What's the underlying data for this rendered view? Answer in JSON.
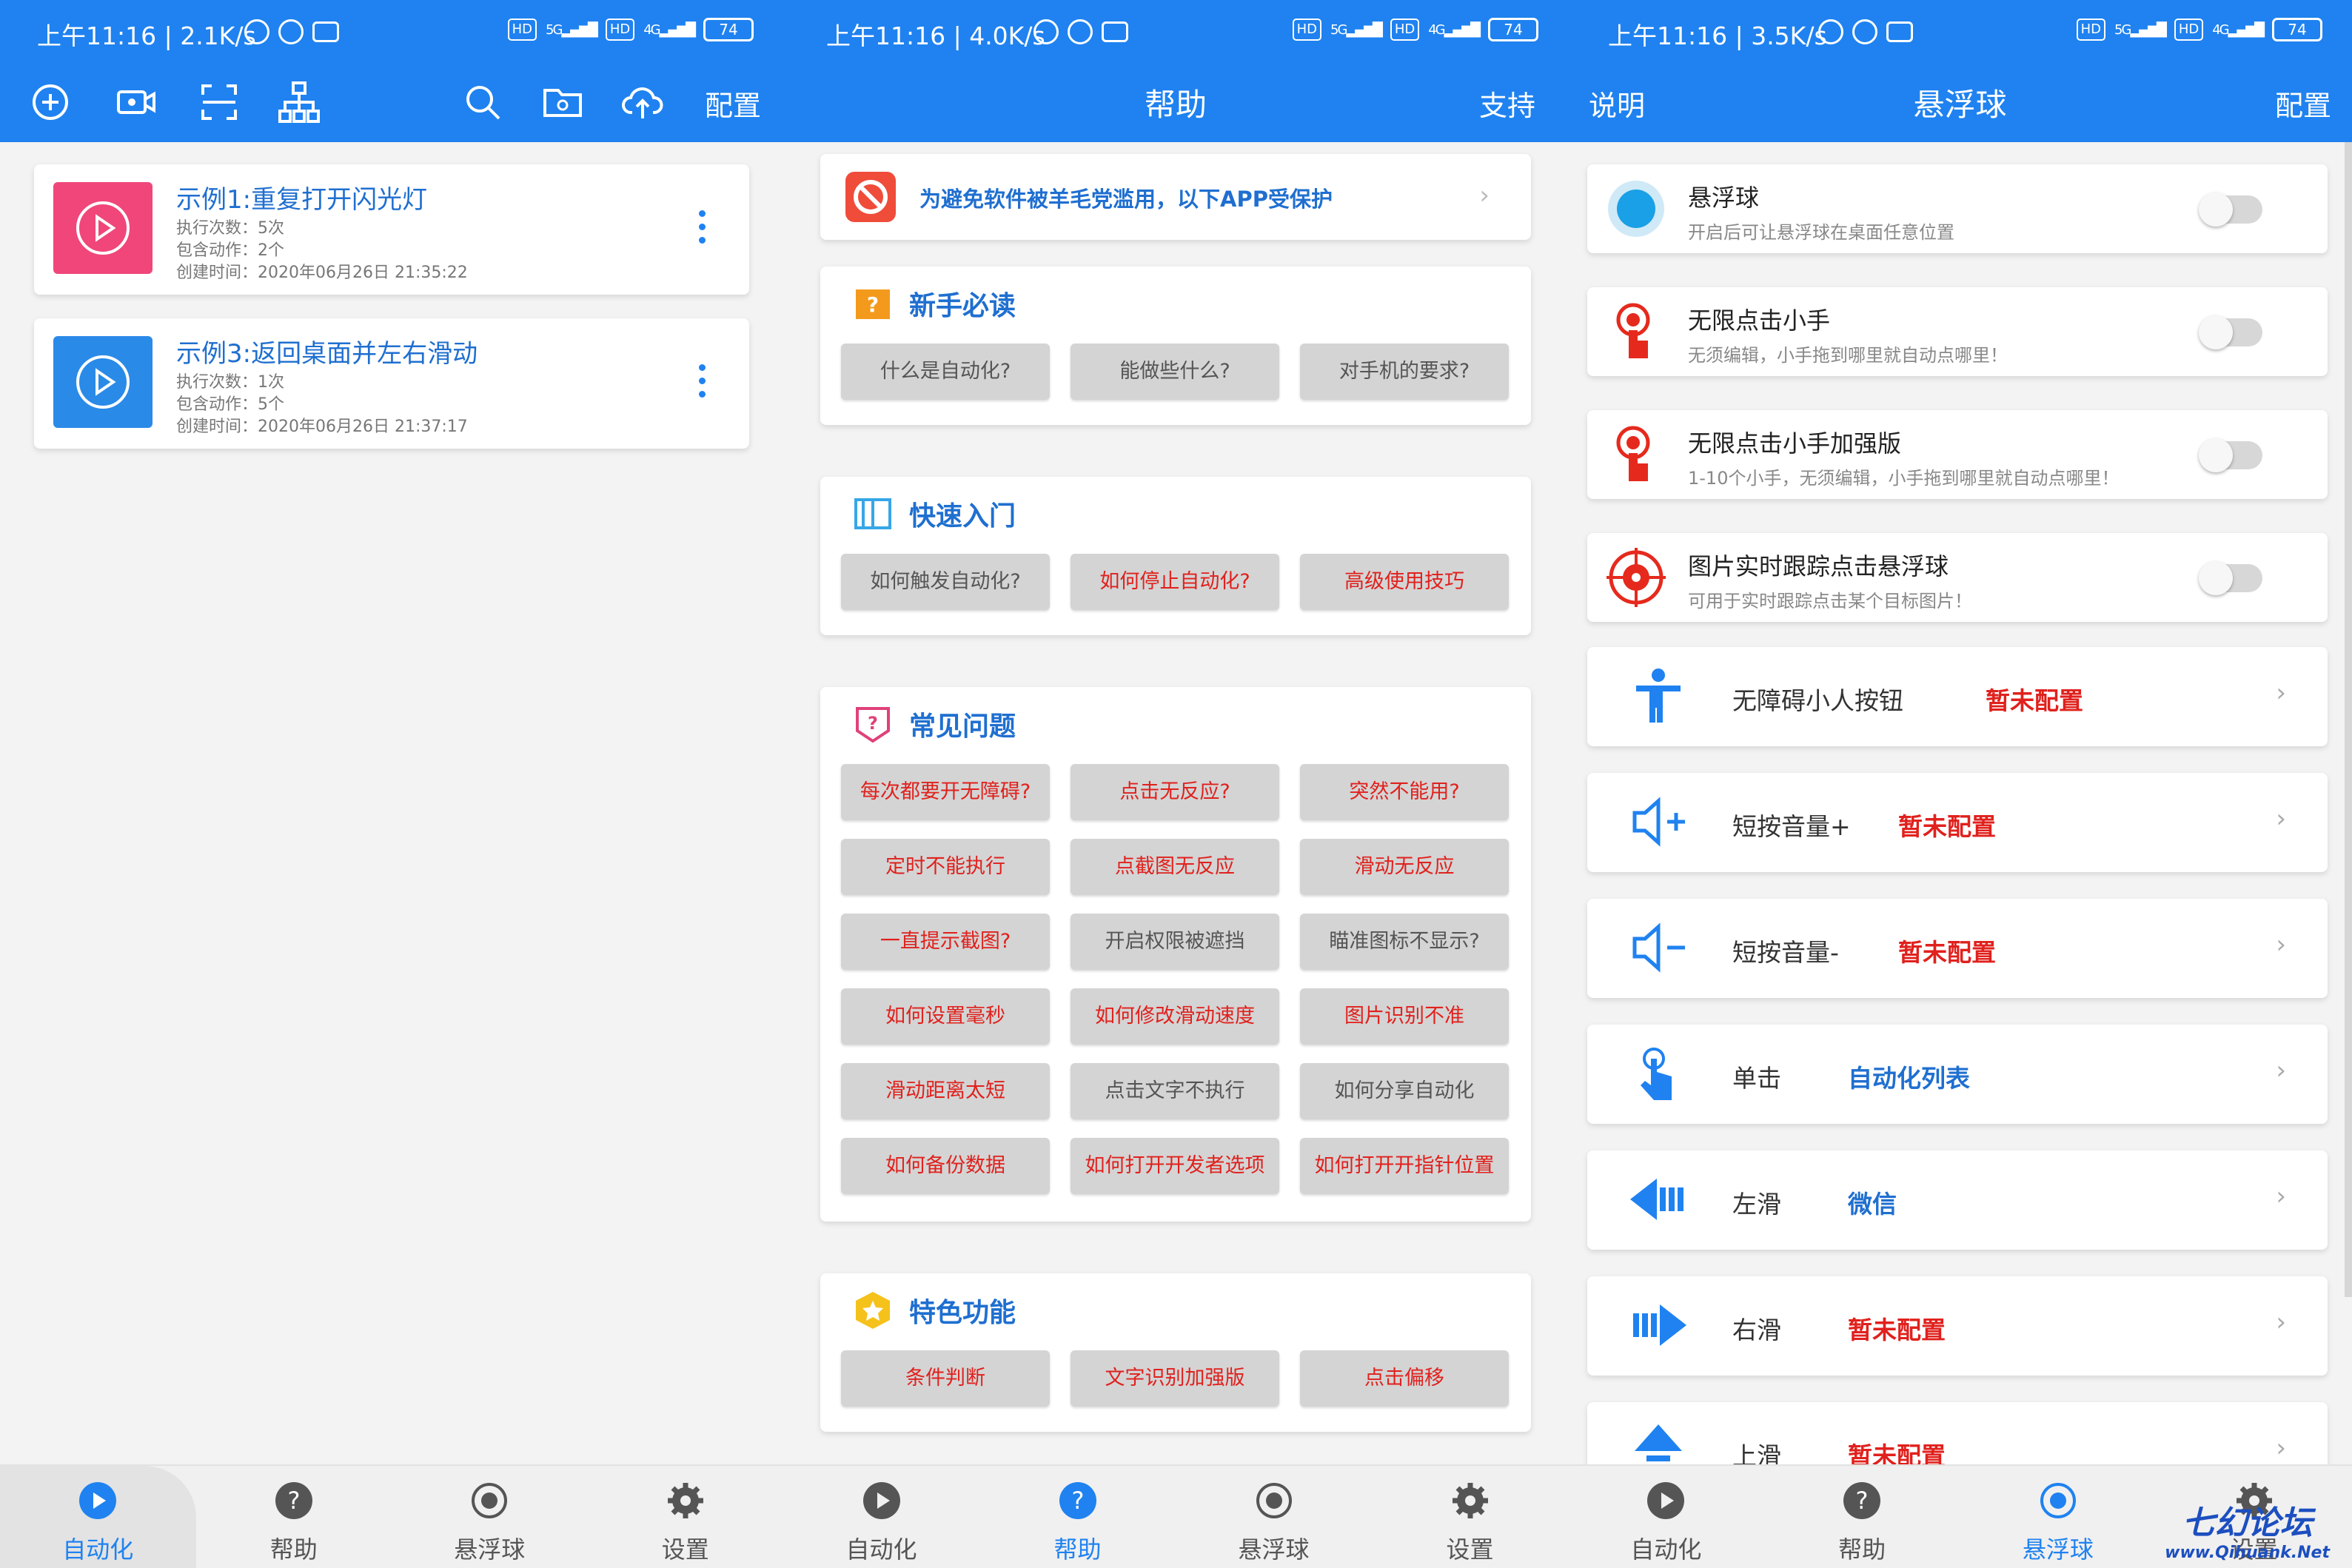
{
  "status_bars": [
    {
      "time": "上午11:16 | 2.1K/s",
      "battery": "74"
    },
    {
      "time": "上午11:16 | 4.0K/s",
      "battery": "74"
    },
    {
      "time": "上午11:16 | 3.5K/s",
      "battery": "74"
    }
  ],
  "status_labels": {
    "hd": "HD",
    "g5": "5G",
    "g4": "4G"
  },
  "panel1": {
    "toolbar": {
      "config_label": "配置"
    },
    "items": [
      {
        "title": "示例1:重复打开闪光灯",
        "runs": "执行次数：5次",
        "actions": "包含动作：2个",
        "created": "创建时间：2020年06月26日 21:35:22",
        "color": "#f0467a"
      },
      {
        "title": "示例3:返回桌面并左右滑动",
        "runs": "执行次数：1次",
        "actions": "包含动作：5个",
        "created": "创建时间：2020年06月26日 21:37:17",
        "color": "#2a8ae8"
      }
    ]
  },
  "panel2": {
    "title": "帮助",
    "right_label": "支持",
    "notice": "为避免软件被羊毛党滥用，以下APP受保护",
    "sections": [
      {
        "title": "新手必读",
        "buttons": [
          {
            "label": "什么是自动化?",
            "red": false
          },
          {
            "label": "能做些什么?",
            "red": false
          },
          {
            "label": "对手机的要求?",
            "red": false
          }
        ]
      },
      {
        "title": "快速入门",
        "buttons": [
          {
            "label": "如何触发自动化?",
            "red": false
          },
          {
            "label": "如何停止自动化?",
            "red": true
          },
          {
            "label": "高级使用技巧",
            "red": true
          }
        ]
      },
      {
        "title": "常见问题",
        "buttons": [
          {
            "label": "每次都要开无障碍?",
            "red": true
          },
          {
            "label": "点击无反应?",
            "red": true
          },
          {
            "label": "突然不能用?",
            "red": true
          },
          {
            "label": "定时不能执行",
            "red": true
          },
          {
            "label": "点截图无反应",
            "red": true
          },
          {
            "label": "滑动无反应",
            "red": true
          },
          {
            "label": "一直提示截图?",
            "red": true
          },
          {
            "label": "开启权限被遮挡",
            "red": false
          },
          {
            "label": "瞄准图标不显示?",
            "red": false
          },
          {
            "label": "如何设置毫秒",
            "red": true
          },
          {
            "label": "如何修改滑动速度",
            "red": true
          },
          {
            "label": "图片识别不准",
            "red": true
          },
          {
            "label": "滑动距离太短",
            "red": true
          },
          {
            "label": "点击文字不执行",
            "red": false
          },
          {
            "label": "如何分享自动化",
            "red": false
          },
          {
            "label": "如何备份数据",
            "red": true
          },
          {
            "label": "如何打开开发者选项",
            "red": true
          },
          {
            "label": "如何打开开指针位置",
            "red": true
          }
        ]
      },
      {
        "title": "特色功能",
        "buttons": [
          {
            "label": "条件判断",
            "red": true
          },
          {
            "label": "文字识别加强版",
            "red": true
          },
          {
            "label": "点击偏移",
            "red": true
          }
        ]
      }
    ]
  },
  "panel3": {
    "title": "悬浮球",
    "left_label": "说明",
    "right_label": "配置",
    "toggles": [
      {
        "title": "悬浮球",
        "sub": "开启后可让悬浮球在桌面任意位置",
        "icon": "floating-ball-icon"
      },
      {
        "title": "无限点击小手",
        "sub": "无须编辑，小手拖到哪里就自动点哪里！",
        "icon": "tap-hand-icon"
      },
      {
        "title": "无限点击小手加强版",
        "sub": "1-10个小手，无须编辑，小手拖到哪里就自动点哪里！",
        "icon": "tap-hand-plus-icon"
      },
      {
        "title": "图片实时跟踪点击悬浮球",
        "sub": "可用于实时跟踪点击某个目标图片！",
        "icon": "target-icon"
      }
    ],
    "actions": [
      {
        "label": "无障碍小人按钮",
        "value": "暂未配置",
        "value_color": "red",
        "icon": "accessibility-person-icon"
      },
      {
        "label": "短按音量+",
        "value": "暂未配置",
        "value_color": "red",
        "icon": "volume-up-icon"
      },
      {
        "label": "短按音量-",
        "value": "暂未配置",
        "value_color": "red",
        "icon": "volume-down-icon"
      },
      {
        "label": "单击",
        "value": "自动化列表",
        "value_color": "blue",
        "icon": "tap-finger-icon"
      },
      {
        "label": "左滑",
        "value": "微信",
        "value_color": "blue",
        "icon": "swipe-left-icon"
      },
      {
        "label": "右滑",
        "value": "暂未配置",
        "value_color": "red",
        "icon": "swipe-right-icon"
      },
      {
        "label": "上滑",
        "value": "暂未配置",
        "value_color": "red",
        "icon": "swipe-up-icon"
      }
    ]
  },
  "nav": {
    "items": [
      "自动化",
      "帮助",
      "悬浮球",
      "设置"
    ],
    "active_index": [
      0,
      1,
      2
    ]
  },
  "watermark": {
    "line1": "七幻论坛",
    "line2": "www.Qihuank.Net"
  },
  "colors": {
    "primary": "#1f82f0",
    "accent_red": "#e0211d",
    "link_blue": "#1f6fd0"
  }
}
